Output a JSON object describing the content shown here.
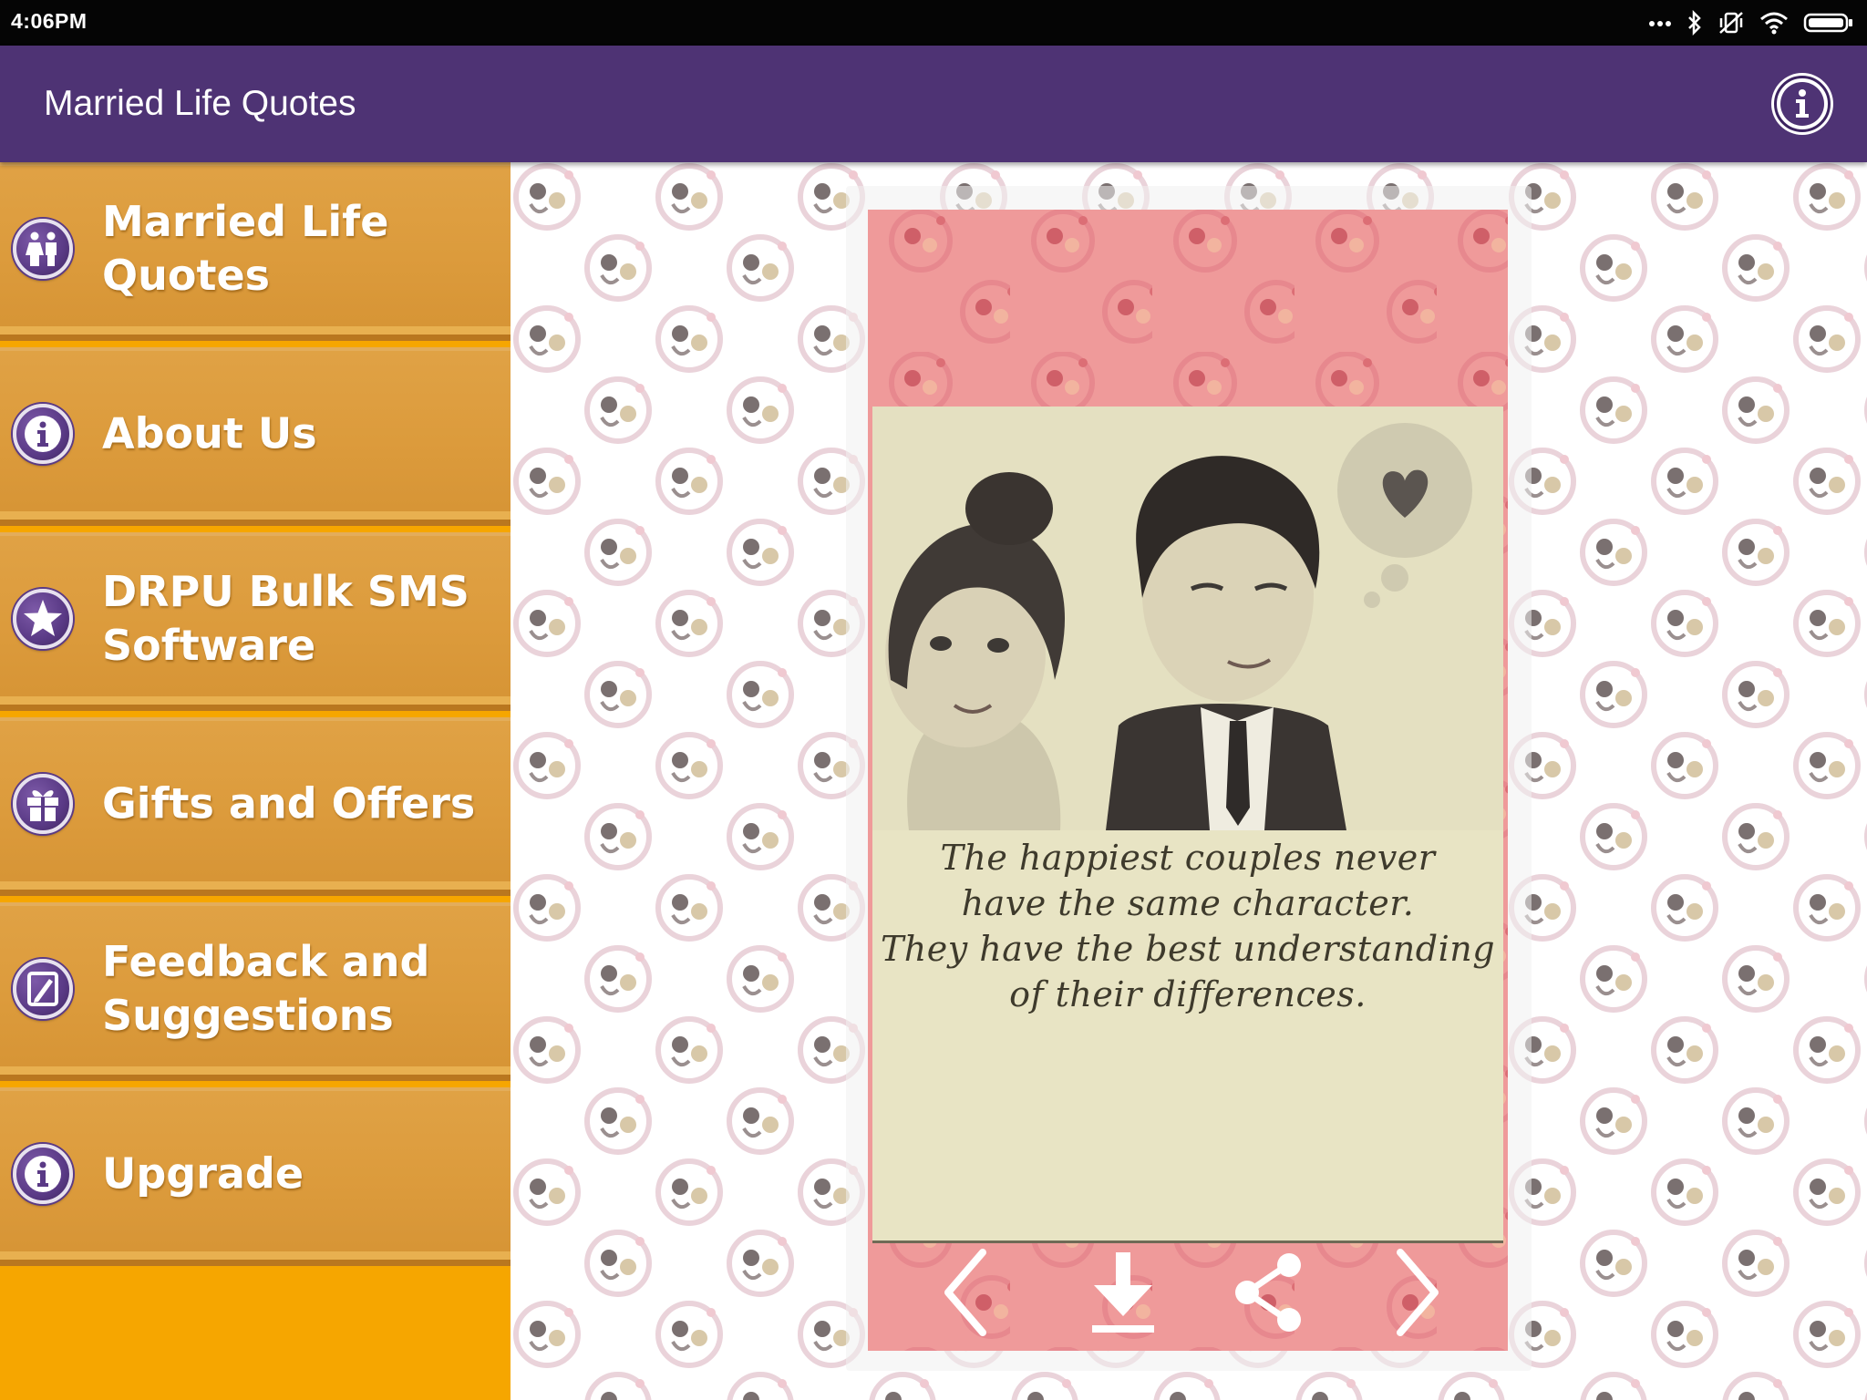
{
  "status_bar": {
    "time": "4:06PM",
    "icons": [
      "more-dots-icon",
      "bluetooth-icon",
      "vibrate-off-icon",
      "wifi-icon",
      "battery-icon"
    ]
  },
  "app_bar": {
    "title": "Married Life Quotes",
    "info_icon": "info-icon",
    "color": "#4e3374"
  },
  "sidebar": {
    "background": "#f6a600",
    "items": [
      {
        "label": "Married Life\nQuotes",
        "icon": "couple-icon"
      },
      {
        "label": "About Us",
        "icon": "info-icon"
      },
      {
        "label": "DRPU Bulk SMS\nSoftware",
        "icon": "star-icon"
      },
      {
        "label": "Gifts and Offers",
        "icon": "gift-icon"
      },
      {
        "label": "Feedback and\nSuggestions",
        "icon": "feedback-icon"
      },
      {
        "label": "Upgrade",
        "icon": "info-icon"
      }
    ]
  },
  "quote": {
    "lines": [
      "The happiest couples never",
      "have the same character.",
      "They have the best understanding",
      "of their differences."
    ]
  },
  "controls": {
    "previous": "chevron-left-icon",
    "download": "download-icon",
    "share": "share-icon",
    "next": "chevron-right-icon"
  }
}
